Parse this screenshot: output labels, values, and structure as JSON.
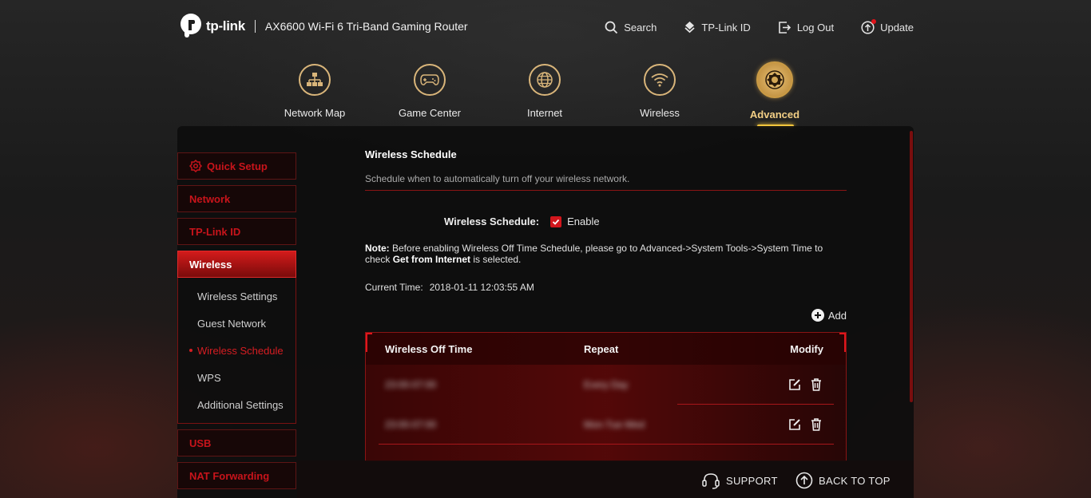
{
  "header": {
    "logo_text": "tp-link",
    "product_name": "AX6600 Wi-Fi 6 Tri-Band Gaming Router",
    "actions": [
      {
        "label": "Search",
        "icon": "search-icon"
      },
      {
        "label": "TP-Link ID",
        "icon": "tplink-id-icon"
      },
      {
        "label": "Log Out",
        "icon": "logout-icon"
      },
      {
        "label": "Update",
        "icon": "update-icon",
        "has_notification": true
      }
    ]
  },
  "main_nav": [
    {
      "label": "Network Map",
      "icon": "network-map-icon",
      "active": false
    },
    {
      "label": "Game Center",
      "icon": "gamepad-icon",
      "active": false
    },
    {
      "label": "Internet",
      "icon": "globe-icon",
      "active": false
    },
    {
      "label": "Wireless",
      "icon": "wifi-icon",
      "active": false
    },
    {
      "label": "Advanced",
      "icon": "advanced-gear-icon",
      "active": true
    }
  ],
  "sidebar": {
    "quick_setup": "Quick Setup",
    "network": "Network",
    "tplink_id": "TP-Link ID",
    "wireless": {
      "label": "Wireless",
      "items": [
        "Wireless Settings",
        "Guest Network",
        "Wireless Schedule",
        "WPS",
        "Additional Settings"
      ],
      "active_item": "Wireless Schedule"
    },
    "usb": "USB",
    "nat_forwarding": "NAT Forwarding"
  },
  "content": {
    "title": "Wireless Schedule",
    "description": "Schedule when to automatically turn off your wireless network.",
    "schedule_label": "Wireless Schedule:",
    "enable_label": "Enable",
    "enable_checked": true,
    "note_prefix": "Note:",
    "note_text_1": " Before enabling Wireless Off Time Schedule, please go to Advanced->System Tools->System Time to check ",
    "note_bold": "Get from Internet",
    "note_text_2": " is selected.",
    "current_time_label": "Current Time:",
    "current_time_value": "2018-01-11 12:03:55 AM",
    "add_label": "Add"
  },
  "table": {
    "columns": [
      "Wireless Off Time",
      "Repeat",
      "Modify"
    ],
    "rows": [
      {
        "off_time": "23:00-07:00",
        "repeat": "Every Day"
      },
      {
        "off_time": "23:00-07:00",
        "repeat": "Mon-Tue-Wed"
      }
    ]
  },
  "footer": {
    "support_label": "SUPPORT",
    "back_to_top_label": "BACK TO TOP"
  },
  "colors": {
    "accent_red": "#d2161c",
    "accent_gold": "#d9b57a",
    "active_indicator": "#f2c53c"
  }
}
